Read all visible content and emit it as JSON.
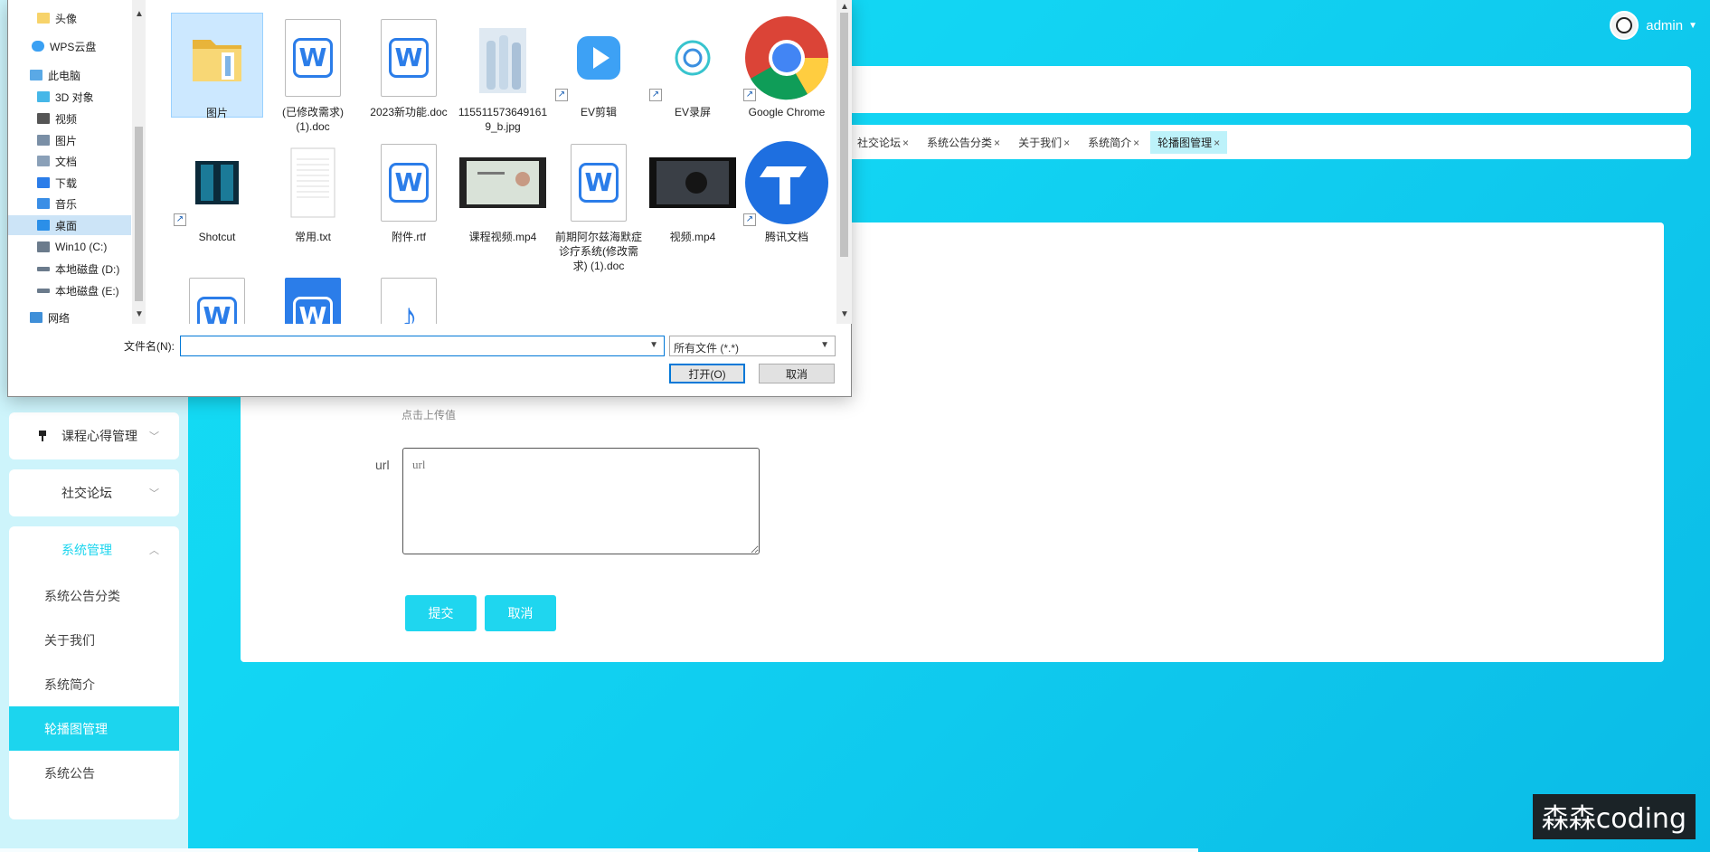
{
  "header": {
    "username": "admin"
  },
  "tabs": [
    {
      "label": "社交论坛",
      "active": false
    },
    {
      "label": "系统公告分类",
      "active": false
    },
    {
      "label": "关于我们",
      "active": false
    },
    {
      "label": "系统简介",
      "active": false
    },
    {
      "label": "轮播图管理",
      "active": true
    }
  ],
  "tab_close_glyph": "×",
  "sidebar": {
    "groups": [
      {
        "label": "课程心得管理",
        "icon": "pin-icon"
      },
      {
        "label": "社交论坛",
        "icon": "grid-icon"
      },
      {
        "label": "系统管理",
        "icon": "grid-icon",
        "expanded": true
      }
    ],
    "sub_items": [
      {
        "label": "系统公告分类",
        "active": false
      },
      {
        "label": "关于我们",
        "active": false
      },
      {
        "label": "系统简介",
        "active": false
      },
      {
        "label": "轮播图管理",
        "active": true
      },
      {
        "label": "系统公告",
        "active": false
      }
    ]
  },
  "form": {
    "upload_hint": "点击上传值",
    "url_label": "url",
    "url_placeholder": "url",
    "submit_label": "提交",
    "cancel_label": "取消"
  },
  "dialog": {
    "nav_items": [
      {
        "label": "头像",
        "icon": "folder-icon"
      },
      {
        "label": "WPS云盘",
        "icon": "cloud-icon"
      },
      {
        "label": "此电脑",
        "icon": "computer-icon"
      },
      {
        "label": "3D 对象",
        "icon": "3d-objects-icon"
      },
      {
        "label": "视频",
        "icon": "video-folder-icon"
      },
      {
        "label": "图片",
        "icon": "pictures-folder-icon"
      },
      {
        "label": "文档",
        "icon": "documents-folder-icon"
      },
      {
        "label": "下载",
        "icon": "download-icon"
      },
      {
        "label": "音乐",
        "icon": "music-icon"
      },
      {
        "label": "桌面",
        "icon": "desktop-icon",
        "selected": true
      },
      {
        "label": "Win10 (C:)",
        "icon": "drive-icon"
      },
      {
        "label": "本地磁盘 (D:)",
        "icon": "drive-icon"
      },
      {
        "label": "本地磁盘 (E:)",
        "icon": "drive-icon"
      },
      {
        "label": "网络",
        "icon": "network-icon"
      }
    ],
    "files": [
      {
        "name": "图片",
        "kind": "folder",
        "selected": true
      },
      {
        "name": "(已修改需求)(1).doc",
        "kind": "wps-doc"
      },
      {
        "name": "2023新功能.doc",
        "kind": "wps-doc"
      },
      {
        "name": "1155115736491619_b.jpg",
        "kind": "image"
      },
      {
        "name": "EV剪辑",
        "kind": "app-ev-edit",
        "shortcut": true
      },
      {
        "name": "EV录屏",
        "kind": "app-ev-record",
        "shortcut": true
      },
      {
        "name": "Google Chrome",
        "kind": "app-chrome",
        "shortcut": true
      },
      {
        "name": "Shotcut",
        "kind": "app-shotcut",
        "shortcut": true
      },
      {
        "name": "常用.txt",
        "kind": "text"
      },
      {
        "name": "附件.rtf",
        "kind": "wps-doc"
      },
      {
        "name": "课程视频.mp4",
        "kind": "video"
      },
      {
        "name": "前期阿尔兹海默症诊疗系统(修改需求) (1).doc",
        "kind": "wps-doc"
      },
      {
        "name": "视频.mp4",
        "kind": "video-dark"
      },
      {
        "name": "腾讯文档",
        "kind": "app-tencent-docs",
        "shortcut": true
      },
      {
        "name": "",
        "kind": "wps-doc"
      },
      {
        "name": "",
        "kind": "wps-blue"
      },
      {
        "name": "",
        "kind": "audio"
      }
    ],
    "filename_label": "文件名(N):",
    "filename_value": "",
    "file_type": "所有文件 (*.*)",
    "open_label": "打开(O)",
    "cancel_label": "取消"
  },
  "watermark": "森森coding",
  "colors": {
    "accent": "#1cd5ee",
    "dialog_selection": "#cce8ff",
    "primary_blue": "#0078d7"
  }
}
